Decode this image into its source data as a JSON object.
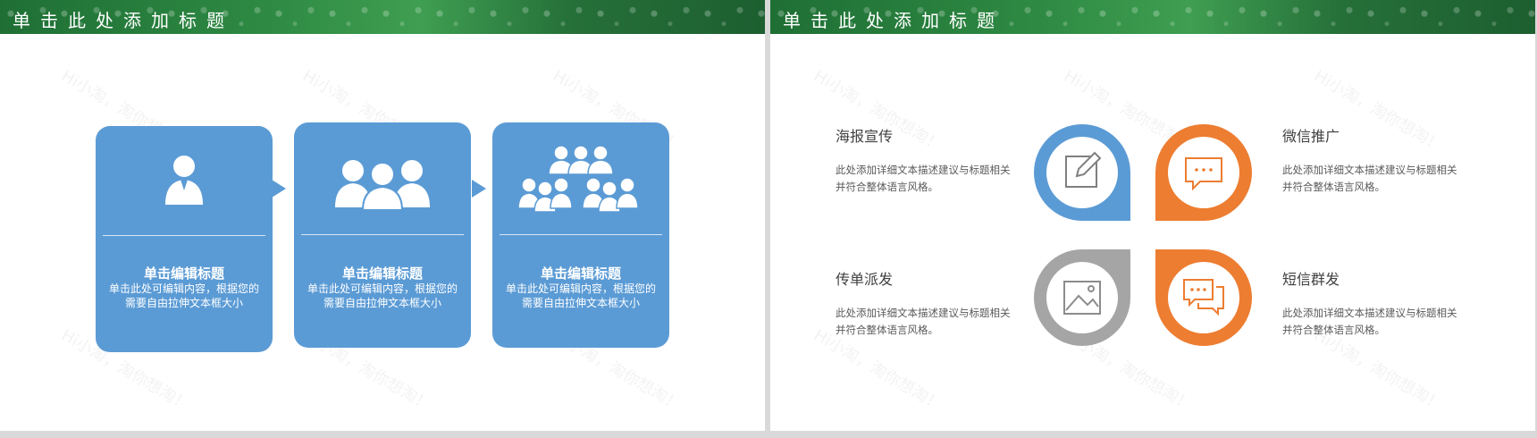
{
  "left_slide": {
    "header_title": "单击此处添加标题",
    "watermark": "Hi小淘，淘你想淘！",
    "cards": [
      {
        "icon": "single-person-icon",
        "title": "单击编辑标题",
        "desc": "单击此处可编辑内容，根据您的需要自由拉伸文本框大小"
      },
      {
        "icon": "three-people-icon",
        "title": "单击编辑标题",
        "desc": "单击此处可编辑内容，根据您的需要自由拉伸文本框大小"
      },
      {
        "icon": "group-people-icon",
        "title": "单击编辑标题",
        "desc": "单击此处可编辑内容，根据您的需要自由拉伸文本框大小"
      }
    ],
    "colors": {
      "card": "#5b9bd5"
    }
  },
  "right_slide": {
    "header_title": "单击此处添加标题",
    "watermark": "Hi小淘，淘你想淘！",
    "items": [
      {
        "title": "海报宣传",
        "desc": "此处添加详细文本描述建议与标题相关并符合整体语言风格。",
        "icon": "edit-icon",
        "color": "#5b9bd5"
      },
      {
        "title": "微信推广",
        "desc": "此处添加详细文本描述建议与标题相关并符合整体语言风格。",
        "icon": "chat-bubble-icon",
        "color": "#ed7d31"
      },
      {
        "title": "传单派发",
        "desc": "此处添加详细文本描述建议与标题相关并符合整体语言风格。",
        "icon": "image-icon",
        "color": "#a5a5a5"
      },
      {
        "title": "短信群发",
        "desc": "此处添加详细文本描述建议与标题相关并符合整体语言风格。",
        "icon": "messages-icon",
        "color": "#ed7d31"
      }
    ]
  }
}
